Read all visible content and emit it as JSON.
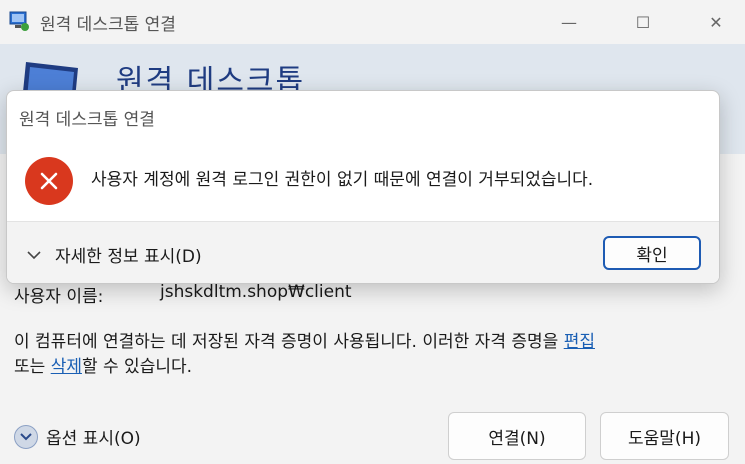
{
  "window": {
    "title": "원격 데스크톱 연결",
    "minimize_glyph": "—",
    "maximize_glyph": "☐",
    "close_glyph": "✕"
  },
  "banner": {
    "title": "원격 데스크톱"
  },
  "main": {
    "username_label": "사용자 이름:",
    "username_value": "jshskdltm.shop₩client",
    "cred_prefix": "이 컴퓨터에 연결하는 데 저장된 자격 증명이 사용됩니다. 이러한 자격 증명을 ",
    "edit_link": "편집",
    "cred_middle": " 또는 ",
    "delete_link": "삭제",
    "cred_suffix": "할 수 있습니다."
  },
  "footer": {
    "options_label": "옵션 표시(O)",
    "connect_label": "연결(N)",
    "help_label": "도움말(H)"
  },
  "dialog": {
    "title": "원격 데스크톱 연결",
    "message": "사용자 계정에 원격 로그인 권한이 없기 때문에 연결이 거부되었습니다.",
    "details_label": "자세한 정보 표시(D)",
    "ok_label": "확인"
  },
  "colors": {
    "accent": "#1e5bb3",
    "error": "#d9381e",
    "banner_title": "#1f3c82"
  },
  "icons": {
    "app": "remote-desktop-icon",
    "error": "error-icon",
    "details": "chevron-down-icon",
    "options": "chevron-down-circle-icon"
  }
}
